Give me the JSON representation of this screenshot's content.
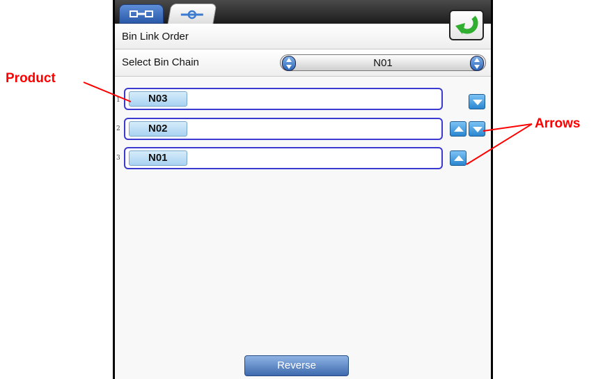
{
  "tabs": [
    {
      "name": "tab-bins",
      "icon": "bin-link-icon"
    },
    {
      "name": "tab-links",
      "icon": "chain-link-icon"
    }
  ],
  "header": {
    "title": "Bin Link Order",
    "back_icon": "return-arrow-icon"
  },
  "chain_select": {
    "label": "Select Bin Chain",
    "value": "N01"
  },
  "rows": [
    {
      "num": "1",
      "product": "N03"
    },
    {
      "num": "2",
      "product": "N02"
    },
    {
      "num": "3",
      "product": "N01"
    }
  ],
  "footer": {
    "reverse_label": "Reverse"
  },
  "callouts": {
    "product": "Product",
    "arrows": "Arrows"
  },
  "colors": {
    "accent_blue": "#2a86cf",
    "callout_red": "#ff0000",
    "row_border": "#3a3ad0"
  }
}
